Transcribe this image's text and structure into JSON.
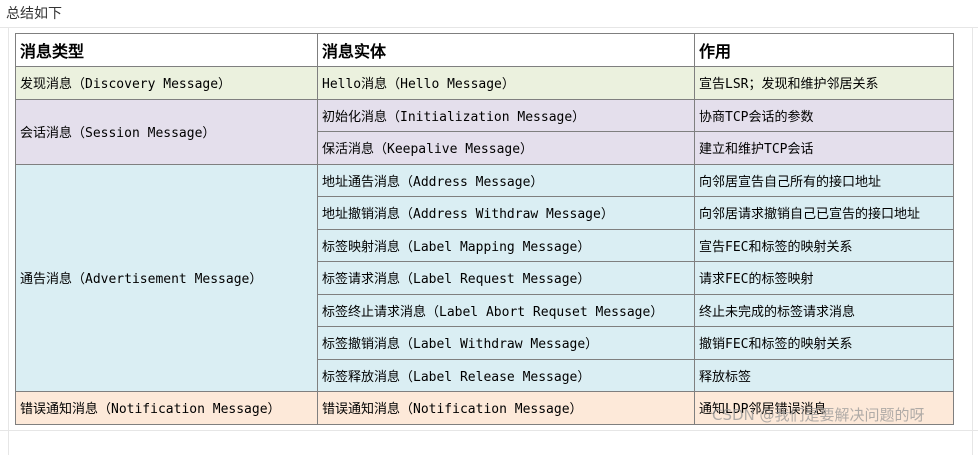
{
  "caption": "总结如下",
  "table": {
    "headers": [
      "消息类型",
      "消息实体",
      "作用"
    ],
    "groups": [
      {
        "type": "发现消息（Discovery Message）",
        "rows": [
          {
            "entity": "Hello消息（Hello Message）",
            "purpose": "宣告LSR；发现和维护邻居关系"
          }
        ]
      },
      {
        "type": "会话消息（Session Message）",
        "rows": [
          {
            "entity": "初始化消息（Initialization Message）",
            "purpose": "协商TCP会话的参数"
          },
          {
            "entity": "保活消息（Keepalive Message）",
            "purpose": "建立和维护TCP会话"
          }
        ]
      },
      {
        "type": "通告消息（Advertisement Message）",
        "rows": [
          {
            "entity": "地址通告消息（Address Message）",
            "purpose": "向邻居宣告自己所有的接口地址"
          },
          {
            "entity": "地址撤销消息（Address Withdraw Message）",
            "purpose": "向邻居请求撤销自己已宣告的接口地址"
          },
          {
            "entity": "标签映射消息（Label Mapping Message）",
            "purpose": "宣告FEC和标签的映射关系"
          },
          {
            "entity": "标签请求消息（Label Request Message）",
            "purpose": "请求FEC的标签映射"
          },
          {
            "entity": "标签终止请求消息（Label Abort Requset Message）",
            "purpose": "终止未完成的标签请求消息"
          },
          {
            "entity": "标签撤销消息（Label Withdraw Message）",
            "purpose": "撤销FEC和标签的映射关系"
          },
          {
            "entity": "标签释放消息（Label Release Message）",
            "purpose": "释放标签"
          }
        ]
      },
      {
        "type": "错误通知消息（Notification Message）",
        "rows": [
          {
            "entity": "错误通知消息（Notification Message）",
            "purpose": "通知LDP邻居错误消息"
          }
        ]
      }
    ]
  },
  "watermark": "CSDN @我们是要解决问题的呀",
  "colors": {
    "discovery": "#ebf1de",
    "session": "#e4dfec",
    "advertisement": "#daeef3",
    "notification": "#fde9d9",
    "border": "#7f7f7f"
  }
}
